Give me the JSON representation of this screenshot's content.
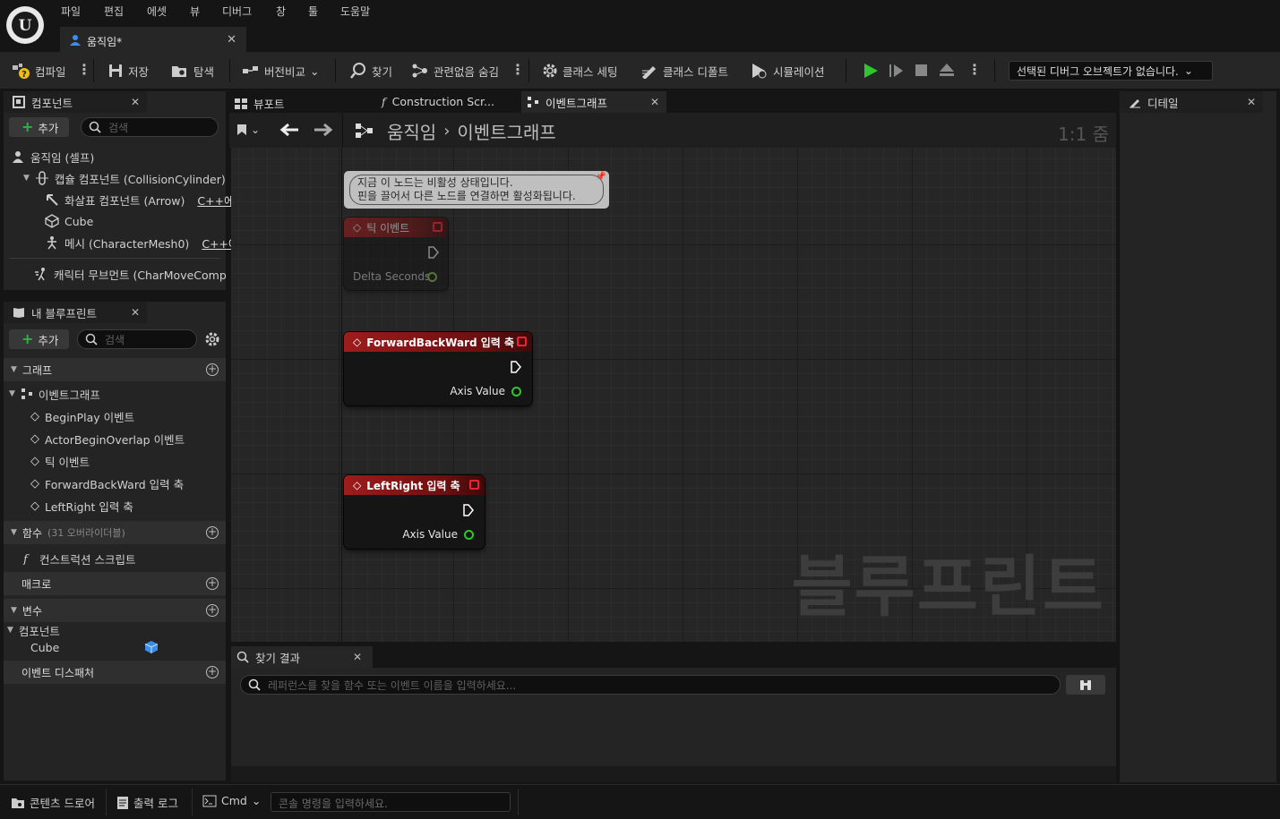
{
  "menubar": {
    "items": [
      "파일",
      "편집",
      "에셋",
      "뷰",
      "디버그",
      "창",
      "툴",
      "도움말"
    ]
  },
  "document_tab": {
    "label": "움직임*"
  },
  "toolbar": {
    "compile": "컴파일",
    "save": "저장",
    "browse": "탐색",
    "diff": "버전비교",
    "find": "찾기",
    "hide_unrelated": "관련없음 숨김",
    "class_settings": "클래스 세팅",
    "class_defaults": "클래스 디폴트",
    "simulation": "시뮬레이션",
    "debug_object": "선택된 디버그 오브젝트가 없습니다."
  },
  "components_panel": {
    "tab": "컴포넌트",
    "add": "추가",
    "search_placeholder": "검색",
    "items": [
      {
        "label": "움직임 (셀프)"
      },
      {
        "label": "캡슐 컴포넌트 (CollisionCylinder)"
      },
      {
        "label": "화살표 컴포넌트 (Arrow)",
        "badge": "C++에..."
      },
      {
        "label": "Cube"
      },
      {
        "label": "메시 (CharacterMesh0)",
        "badge": "C++에/..."
      },
      {
        "label": "캐릭터 무브먼트 (CharMoveComp"
      }
    ]
  },
  "my_blueprint": {
    "tab": "내 블루프린트",
    "add": "추가",
    "search_placeholder": "검색",
    "graphs_section": "그래프",
    "event_graph": "이벤트그래프",
    "events": [
      "BeginPlay 이벤트",
      "ActorBeginOverlap 이벤트",
      "틱 이벤트",
      "ForwardBackWard 입력 축",
      "LeftRight 입력 축"
    ],
    "functions_section": "함수",
    "functions_note": "(31 오버라이더블)",
    "construction_script": "컨스트럭션 스크립트",
    "macros_section": "매크로",
    "variables_section": "변수",
    "components_group": "컴포넌트",
    "variable_cube": "Cube",
    "dispatchers_section": "이벤트 디스패처"
  },
  "editor_tabs": {
    "viewport": "뷰포트",
    "construction": "Construction Scr...",
    "event_graph": "이벤트그래프"
  },
  "breadcrumb": {
    "root": "움직임",
    "current": "이벤트그래프",
    "zoom": "1:1 줌"
  },
  "graph": {
    "comment_line1": "지금 이 노드는 비활성 상태입니다.",
    "comment_line2": "핀을 끌어서 다른 노드를 연결하면 활성화됩니다.",
    "tick_node": {
      "title": "틱 이벤트",
      "pin": "Delta Seconds"
    },
    "fb_node": {
      "title": "ForwardBackWard 입력 축",
      "pin": "Axis Value"
    },
    "lr_node": {
      "title": "LeftRight 입력 축",
      "pin": "Axis Value"
    },
    "watermark": "블루프린트"
  },
  "details_panel": {
    "tab": "디테일"
  },
  "find_results": {
    "tab": "찾기 결과",
    "placeholder": "레퍼런스를 찾을 함수 또는 이벤트 이름을 입력하세요..."
  },
  "statusbar": {
    "content_drawer": "콘텐츠 드로어",
    "output_log": "출력 로그",
    "cmd": "Cmd",
    "console_placeholder": "콘솔 명령을 입력하세요."
  },
  "colors": {
    "node_header": "#9e1c1c",
    "exec_green": "#2ec52e",
    "pin_red": "#e22233",
    "accent_blue": "#3d8ee8"
  }
}
